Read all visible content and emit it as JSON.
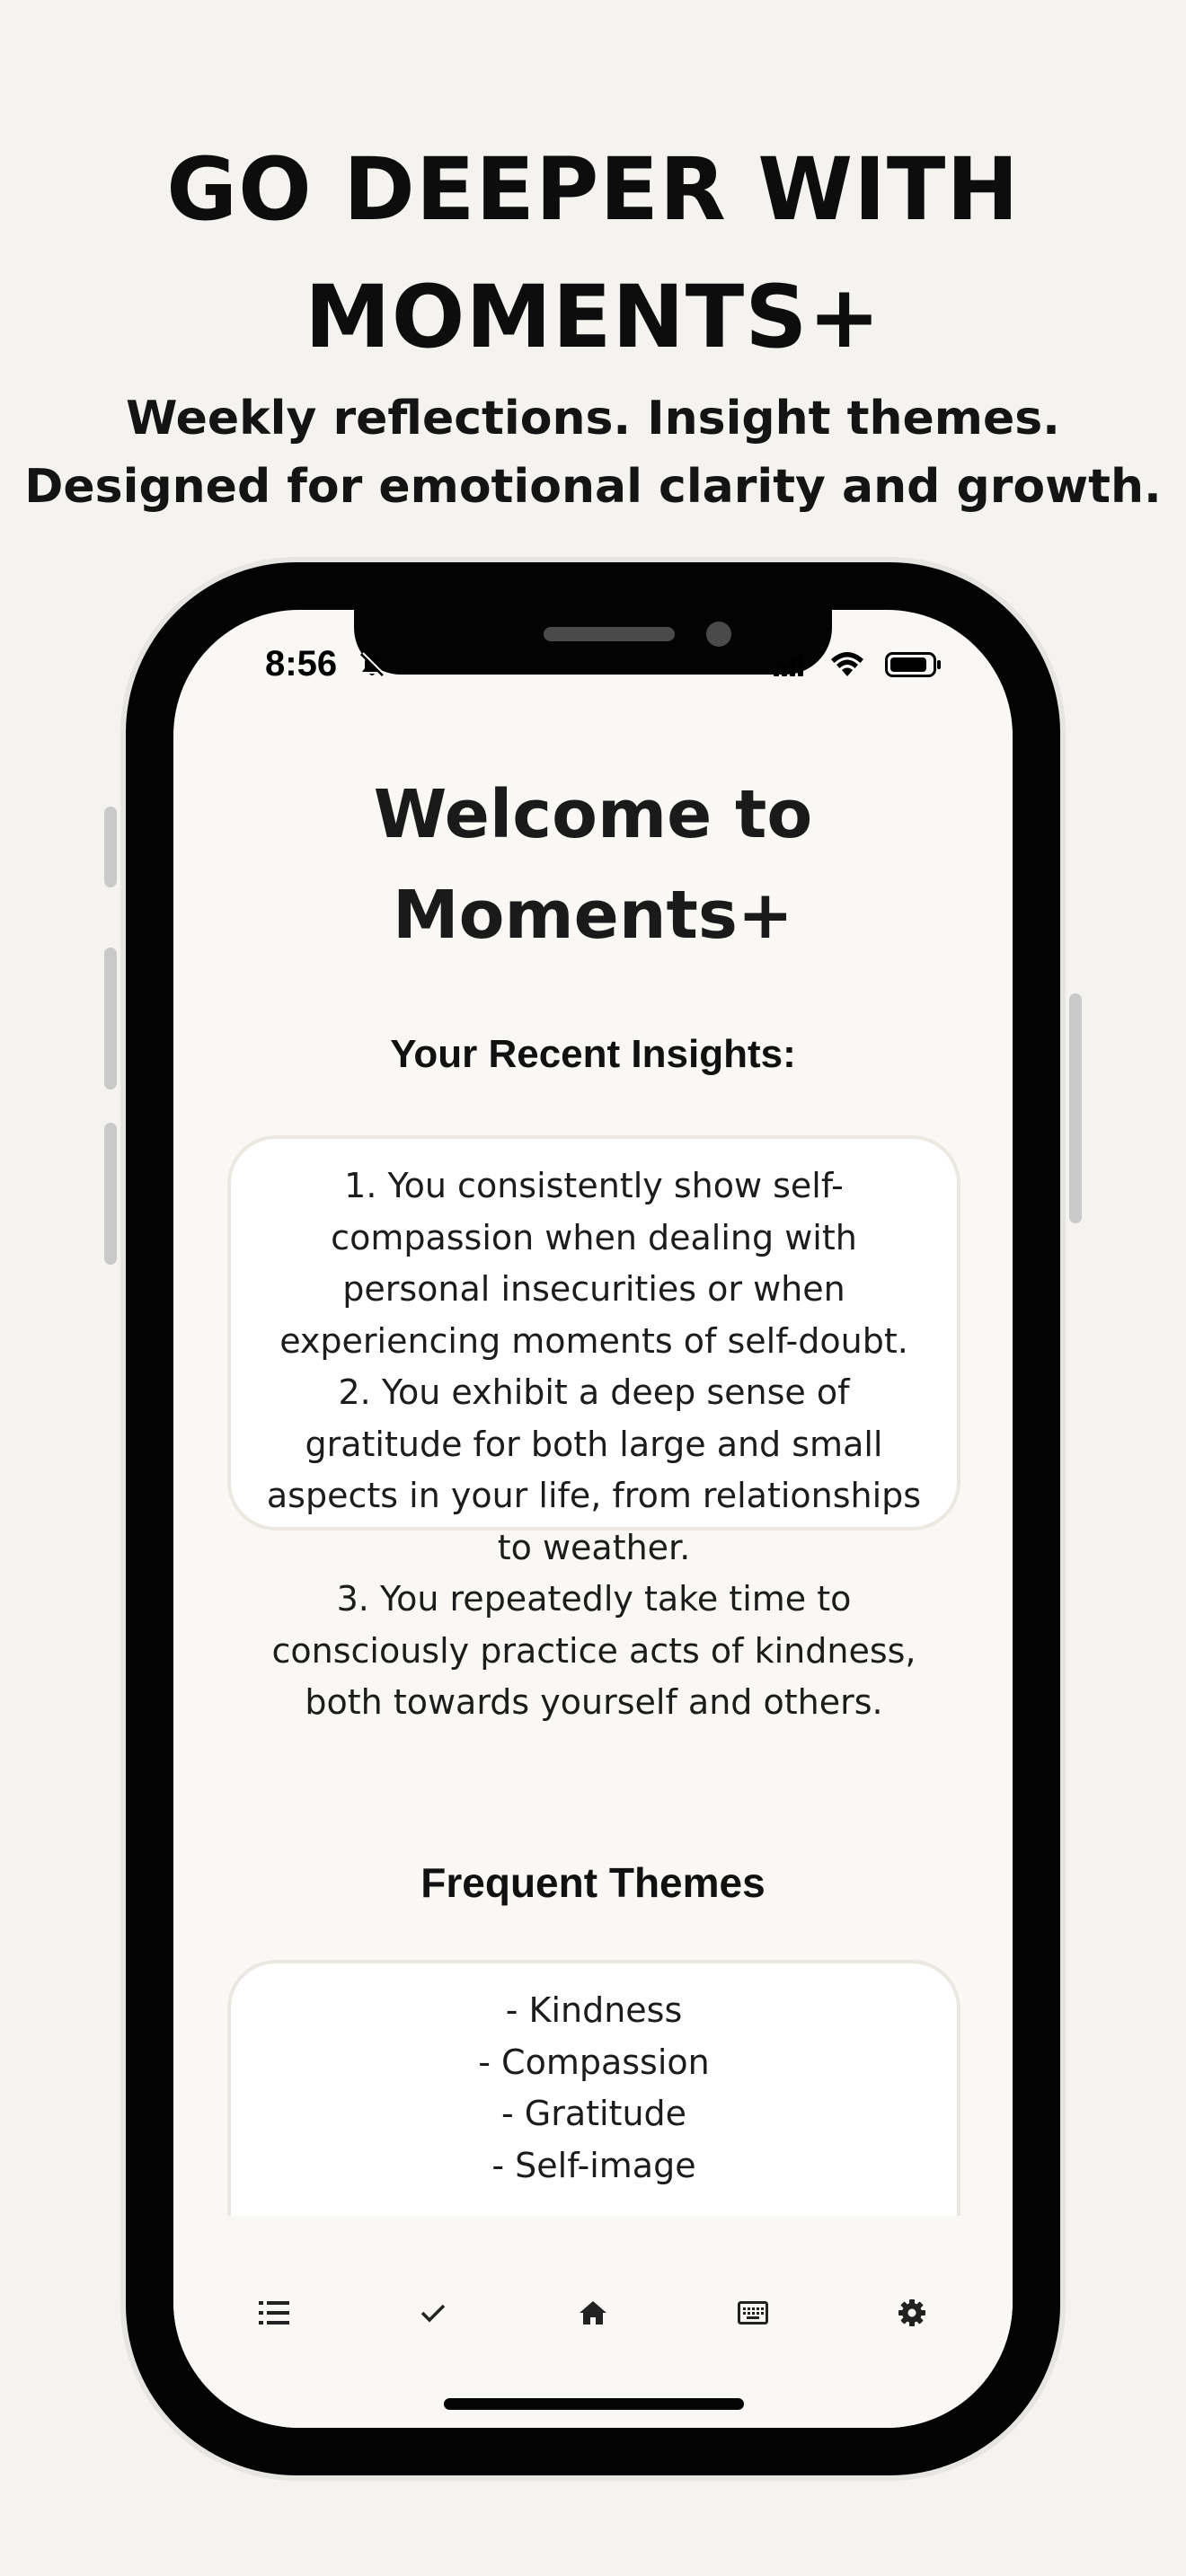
{
  "promo": {
    "headline_line1": "GO DEEPER WITH",
    "headline_line2": "MOMENTS+",
    "subhead_line1": "Weekly reflections. Insight themes.",
    "subhead_line2": "Designed for emotional clarity and growth."
  },
  "status_bar": {
    "time": "8:56",
    "icons": [
      "bell-slash-icon",
      "cellular-signal-icon",
      "wifi-icon",
      "battery-icon"
    ]
  },
  "screen": {
    "welcome_line1": "Welcome to",
    "welcome_line2": "Moments+",
    "insights_title": "Your Recent Insights:",
    "insights_lines": [
      "1. You consistently show self-",
      "compassion when dealing with",
      "personal insecurities or when",
      "experiencing moments of self-doubt.",
      "2. You exhibit a deep sense of",
      "gratitude for both large and small",
      "aspects in your life, from relationships",
      "to weather.",
      "3. You repeatedly take time to",
      "consciously practice acts of kindness,",
      "both towards yourself and others."
    ],
    "themes_title": "Frequent Themes",
    "themes": [
      "- Kindness",
      "- Compassion",
      "- Gratitude",
      "- Self-image"
    ]
  },
  "nav": {
    "items": [
      "list-icon",
      "check-icon",
      "home-icon",
      "keyboard-icon",
      "settings-gear-icon"
    ]
  },
  "colors": {
    "page_background": "#f4f3f0",
    "screen_background": "#f9f8f5",
    "card_background": "#ffffff",
    "card_border": "#ebe8e1",
    "phone_frame": "#030303"
  }
}
